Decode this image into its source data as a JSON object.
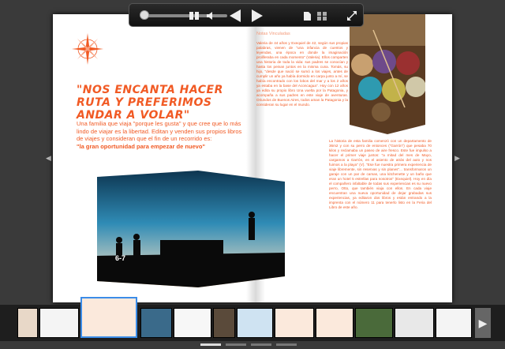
{
  "toolbar": {
    "zoom_level": 0.05,
    "icons": [
      "zoom-slider",
      "two-page-icon",
      "volume-icon",
      "previous-arrow",
      "next-arrow",
      "single-page-icon",
      "grid-icon",
      "fullscreen-icon"
    ]
  },
  "spread": {
    "headline": "\"NOS ENCANTA HACER RUTA Y PREFERIMOS ANDAR A VOLAR\"",
    "lead_text": "Una familia que viaja \"porque les gusta\" y que cree que lo más lindo de viajar es la libertad. Editan y venden sus propios libros de viajes y consideran que el fin de un recorrido es:",
    "lead_bold": "\"la gran oportunidad para empezar de nuevo\"",
    "page_number": "6-7",
    "section_label": "Notas Vinculadas",
    "column_1": "Valeria de 44 años y Exequiel de 42, según sus propias palabras, vienen de \"una infancia de cuentos y leyendas, una época en donde la imaginación proliferaba en cada momento\" (Valeria). Ellos comparten una historia de toda la vida: sus padres se conocían y hasta los peinan juntos en la misma cuna. Tomás, su hijo, \"desde que nació se sumó a los viajes, antes de cumplir un año ya había dormido en carpa junto a mí, se había encontrado con los lobos del mar y a los 2 años ya estaba en la base del Aconcagua\". Hoy con 12 años ya edita su propio libro Una vuelta por la Patagonia, y acompaña a sus padres en este viaje de aventuras. Oriundos de Buenos Aires, todos aman la Patagonia y la consideran su lugar en el mundo.",
    "column_2": "La historia de esta familia comenzó con un departamento de 36m2 y con su perro de entonces (\"Garrón\") que pesaba 70 kilos y reclamaba un paseo de aire fresco. Este fue impulso a hacer el primer viaje juntos: \"a mitad del mes de Mayo, cargamos a Garrón, en el asiento de atrás del auto y nos fuimos a la playa\" (V). \"Ese fue nuestra primera experiencia de viaje libremente, sin reservas y sin planes\"... transformaron un garaje con un par de camas, una kitchenette y un baño que eran un hotel 5 estrellas para nosotros\" (Exequiel). Hoy en día el compañero infaltable de todas sus experiencias es su nuevo perro, Otto, que también viaja con ellos. En cada viaje encuentran una nueva oportunidad de dejar grabadas sus experiencias, ya editaron dos libros y están entrando a la imprenta con el número 11 para tenerlo listo en la Feria del Libro de este año."
  },
  "thumbnails": {
    "count": 14,
    "active_index": 2
  },
  "pager": {
    "count": 4,
    "active_index": 0
  },
  "colors": {
    "accent": "#f15a24",
    "active_thumb": "#3b8ce8"
  }
}
